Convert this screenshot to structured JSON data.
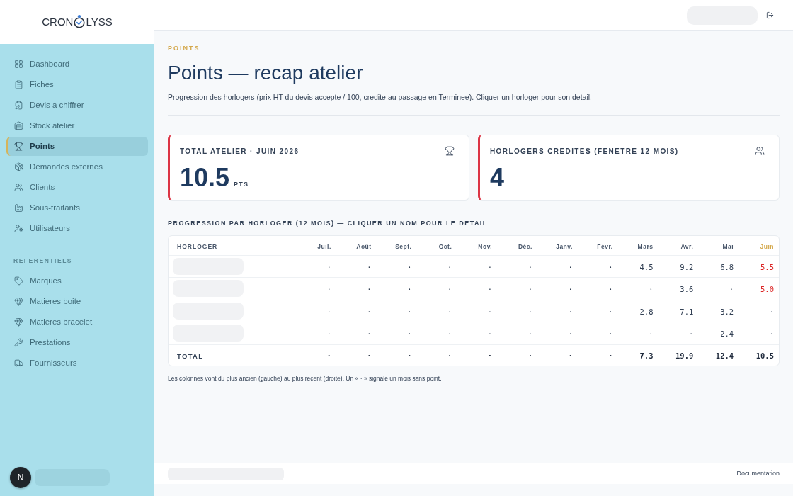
{
  "logo": {
    "left": "CRON",
    "right": "LYSS"
  },
  "sidebar": {
    "items": [
      {
        "label": "Dashboard",
        "selected": false
      },
      {
        "label": "Fiches",
        "selected": false
      },
      {
        "label": "Devis a chiffrer",
        "selected": false
      },
      {
        "label": "Stock atelier",
        "selected": false
      },
      {
        "label": "Points",
        "selected": true
      },
      {
        "label": "Demandes externes",
        "selected": false
      },
      {
        "label": "Clients",
        "selected": false
      },
      {
        "label": "Sous-traitants",
        "selected": false
      },
      {
        "label": "Utilisateurs",
        "selected": false
      }
    ],
    "sections": [
      {
        "title": "REFERENTIELS",
        "items": [
          {
            "label": "Marques",
            "selected": false
          },
          {
            "label": "Matieres boite",
            "selected": false
          },
          {
            "label": "Matieres bracelet",
            "selected": false
          },
          {
            "label": "Prestations",
            "selected": false
          },
          {
            "label": "Fournisseurs",
            "selected": false
          }
        ]
      }
    ],
    "user": {
      "initial": "N"
    }
  },
  "page": {
    "eyebrow": "POINTS",
    "title": "Points — recap atelier",
    "subtitle": "Progression des horlogers (prix HT du devis accepte / 100, credite au passage en Terminee). Cliquer un horloger pour son detail."
  },
  "stats": [
    {
      "label": "TOTAL ATELIER · JUIN 2026",
      "value": "10.5",
      "unit": "PTS"
    },
    {
      "label": "HORLOGERS CREDITES (FENETRE 12 MOIS)",
      "value": "4"
    }
  ],
  "progression": {
    "title": "PROGRESSION PAR HORLOGER (12 MOIS) — CLIQUER UN NOM POUR LE DETAIL",
    "table": {
      "columns": [
        {
          "label": "HORLOGER",
          "current": false
        },
        {
          "label": "Juil.",
          "current": false
        },
        {
          "label": "Août",
          "current": false
        },
        {
          "label": "Sept.",
          "current": false
        },
        {
          "label": "Oct.",
          "current": false
        },
        {
          "label": "Nov.",
          "current": false
        },
        {
          "label": "Déc.",
          "current": false
        },
        {
          "label": "Janv.",
          "current": false
        },
        {
          "label": "Févr.",
          "current": false
        },
        {
          "label": "Mars",
          "current": false
        },
        {
          "label": "Avr.",
          "current": false
        },
        {
          "label": "Mai",
          "current": false
        },
        {
          "label": "Juin",
          "current": true
        }
      ],
      "rows": [
        {
          "cells": [
            "",
            "·",
            "·",
            "·",
            "·",
            "·",
            "·",
            "·",
            "·",
            "4.5",
            "9.2",
            "6.8",
            "5.5"
          ],
          "highlight": true
        },
        {
          "cells": [
            "",
            "·",
            "·",
            "·",
            "·",
            "·",
            "·",
            "·",
            "·",
            "·",
            "3.6",
            "·",
            "5.0"
          ],
          "highlight": true
        },
        {
          "cells": [
            "",
            "·",
            "·",
            "·",
            "·",
            "·",
            "·",
            "·",
            "·",
            "2.8",
            "7.1",
            "3.2",
            "·"
          ],
          "highlight": false
        },
        {
          "cells": [
            "",
            "·",
            "·",
            "·",
            "·",
            "·",
            "·",
            "·",
            "·",
            "·",
            "·",
            "2.4",
            "·"
          ],
          "highlight": false
        }
      ],
      "total": {
        "cells": [
          "TOTAL",
          "·",
          "·",
          "·",
          "·",
          "·",
          "·",
          "·",
          "·",
          "7.3",
          "19.9",
          "12.4",
          "10.5"
        ]
      }
    },
    "note": "Les colonnes vont du plus ancien (gauche) au plus recent (droite). Un « · » signale un mois sans point."
  },
  "footer": {
    "link": "Documentation"
  }
}
